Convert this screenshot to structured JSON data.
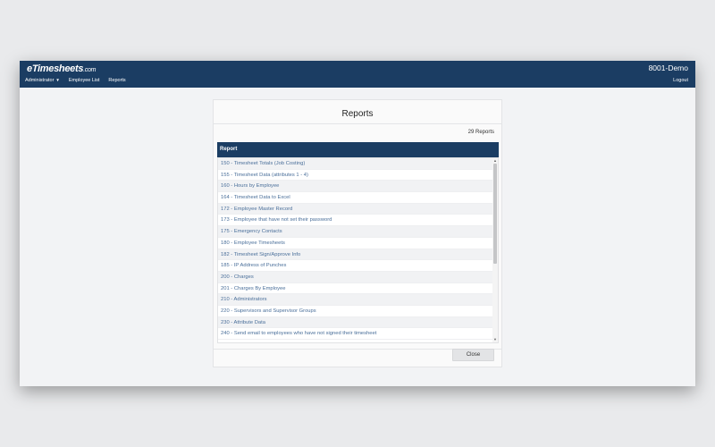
{
  "app": {
    "logo_main": "eTimesheets",
    "logo_suffix": ".com",
    "company": "8001-Demo"
  },
  "nav": {
    "administrator": "Administrator",
    "employee_list": "Employee List",
    "reports": "Reports",
    "logout": "Logout"
  },
  "modal": {
    "title": "Reports",
    "count": "29 Reports",
    "column_header": "Report",
    "close_label": "Close",
    "reports": [
      "150 - Timesheet Totals (Job Costing)",
      "155 - Timesheet Data (attributes 1 - 4)",
      "160 - Hours by Employee",
      "164 - Timesheet Data to Excel",
      "172 - Employee Master Record",
      "173 - Employee that have not set their password",
      "175 - Emergency Contacts",
      "180 - Employee Timesheets",
      "182 - Timesheet Sign/Approve Info",
      "185 - IP Address of Punches",
      "200 - Charges",
      "201 - Charges By Employee",
      "210 - Administrators",
      "220 - Supervisors and Supervisor Groups",
      "230 - Attribute Data",
      "240 - Send email to employees who have not signed their timesheet"
    ]
  },
  "colors": {
    "header_bg": "#1b3d63",
    "link": "#4a6f9a"
  }
}
